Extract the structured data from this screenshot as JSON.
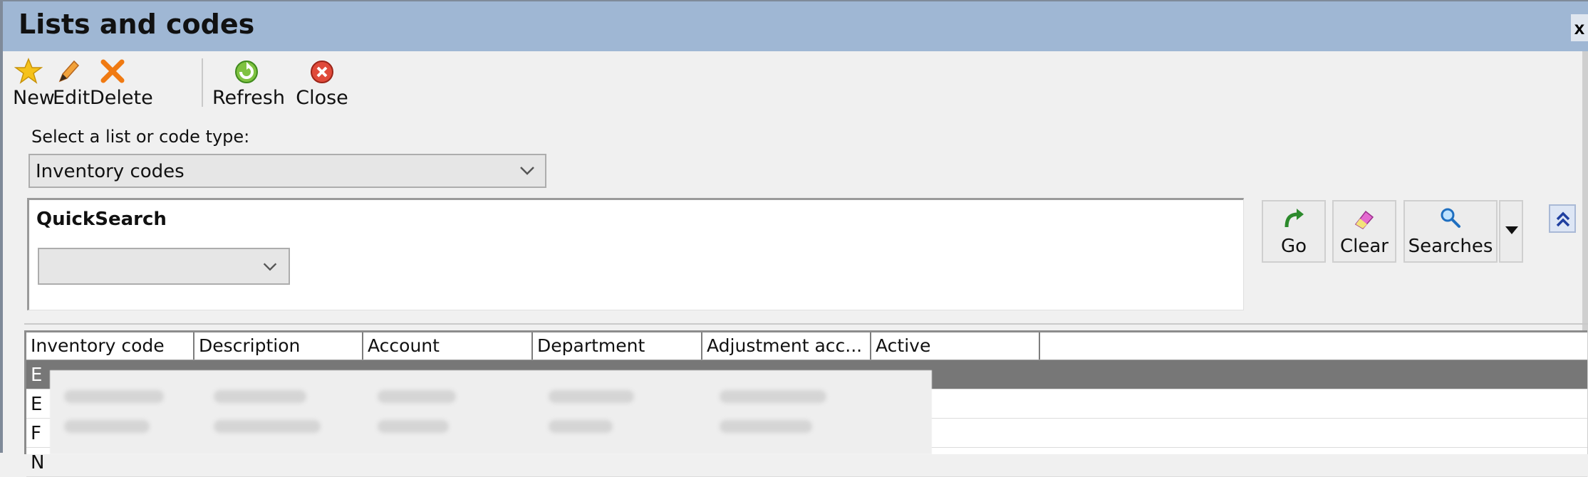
{
  "window": {
    "title": "Lists and codes",
    "close_label": "x"
  },
  "toolbar": [
    {
      "label": "New",
      "icon": "star-icon"
    },
    {
      "label": "Edit",
      "icon": "pencil-icon"
    },
    {
      "label": "Delete",
      "icon": "delete-x-icon"
    },
    {
      "label": "Refresh",
      "icon": "refresh-icon"
    },
    {
      "label": "Close",
      "icon": "close-circle-icon"
    }
  ],
  "selector": {
    "label": "Select a list or code type:",
    "value": "Inventory codes"
  },
  "quicksearch": {
    "title": "QuickSearch",
    "value": ""
  },
  "search_buttons": [
    {
      "label": "Go",
      "icon": "go-arrow-icon"
    },
    {
      "label": "Clear",
      "icon": "eraser-icon"
    },
    {
      "label": "Searches",
      "icon": "magnifier-icon"
    }
  ],
  "grid": {
    "columns": [
      "Inventory code",
      "Description",
      "Account",
      "Department",
      "Adjustment acc...",
      "Active"
    ],
    "rows": [
      {
        "code": "E",
        "selected": true
      },
      {
        "code": "E",
        "selected": false
      },
      {
        "code": "F",
        "selected": false
      },
      {
        "code": "N",
        "selected": false
      }
    ]
  },
  "colors": {
    "titlebar": "#9fb7d4",
    "selected_row": "#777777"
  }
}
